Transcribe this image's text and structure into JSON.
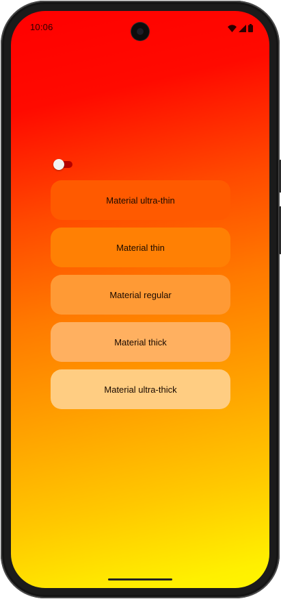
{
  "status_bar": {
    "time": "10:06",
    "icons": [
      "wifi-icon",
      "cellular-signal-icon",
      "battery-icon"
    ]
  },
  "toggle": {
    "state": "off"
  },
  "materials": [
    {
      "label": "Material ultra-thin",
      "color": "#ff5a00"
    },
    {
      "label": "Material thin",
      "color": "#ff8004"
    },
    {
      "label": "Material regular",
      "color": "#ff9a35"
    },
    {
      "label": "Material thick",
      "color": "#ffb060"
    },
    {
      "label": "Material ultra-thick",
      "color": "#ffcd82"
    }
  ],
  "colors": {
    "gradient_top": "#ff0000",
    "gradient_bottom": "#fff500"
  }
}
